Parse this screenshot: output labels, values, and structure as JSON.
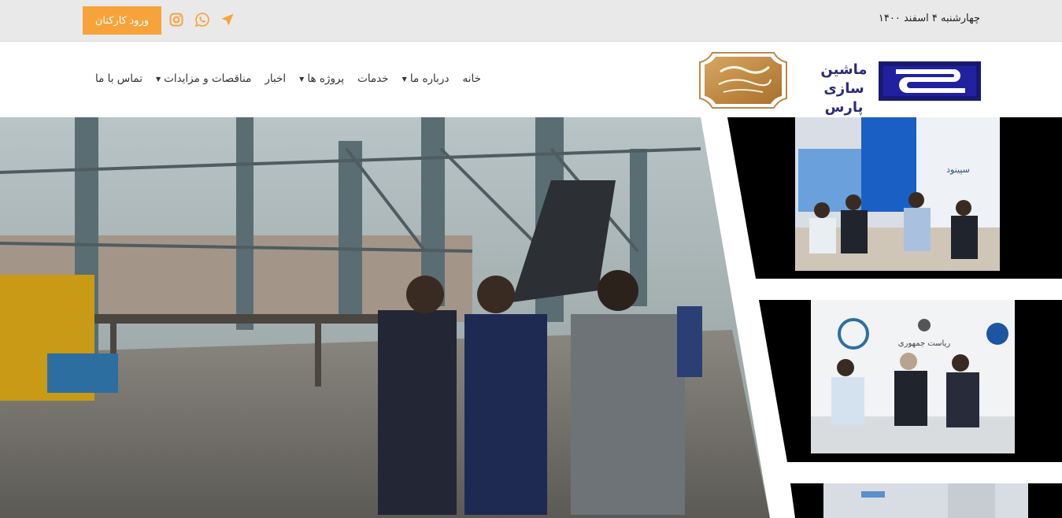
{
  "topbar": {
    "date": "چهارشنبه ۴ اسفند ۱۴۰۰",
    "login_label": "ورود کارکنان",
    "icons": [
      "instagram-icon",
      "whatsapp-icon",
      "location-arrow-icon"
    ],
    "accent": "#f7a33b"
  },
  "header": {
    "logo_line1": "ماشین سازی",
    "logo_line2": "پارس",
    "brand_color": "#2b2b7a",
    "nav": [
      {
        "label": "خانه",
        "dropdown": false
      },
      {
        "label": "درباره ما",
        "dropdown": true
      },
      {
        "label": "خدمات",
        "dropdown": false
      },
      {
        "label": "پروژه ها",
        "dropdown": true
      },
      {
        "label": "اخبار",
        "dropdown": false
      },
      {
        "label": "مناقصات و مزایدات",
        "dropdown": true
      },
      {
        "label": "تماس با ما",
        "dropdown": false
      }
    ]
  },
  "hero": {
    "thumbs": [
      {
        "text": "سپینود"
      },
      {
        "text": "ریاست جمهوری"
      }
    ]
  }
}
